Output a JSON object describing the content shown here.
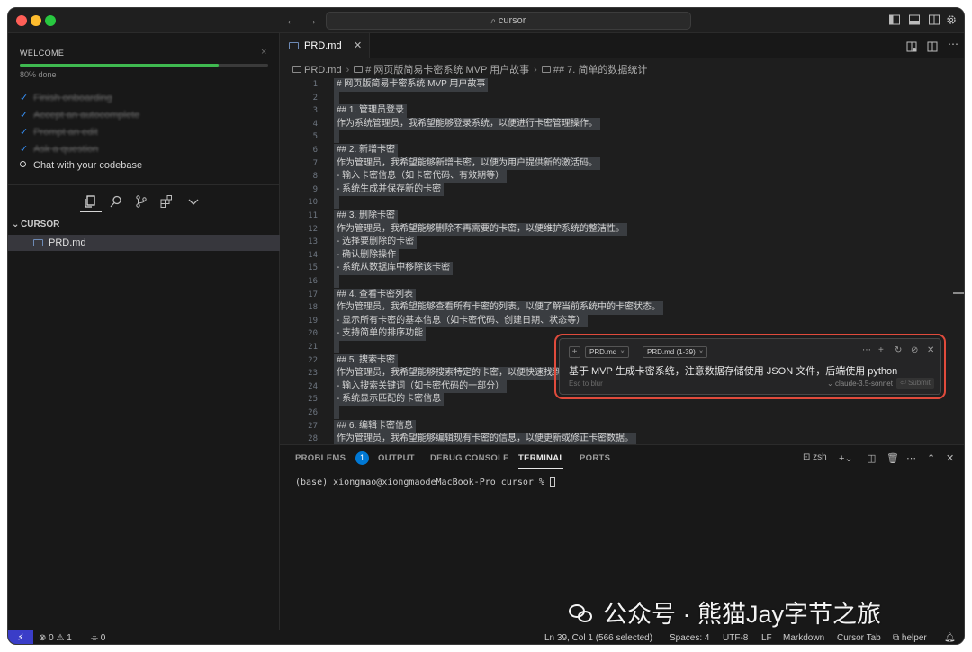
{
  "titlebar": {
    "search": "cursor"
  },
  "welcome": {
    "title": "WELCOME",
    "progress_text": "80% done",
    "progress": 0.8,
    "steps": [
      {
        "label": "Finish onboarding",
        "done": true
      },
      {
        "label": "Accept an autocomplete",
        "done": true
      },
      {
        "label": "Prompt an edit",
        "done": true
      },
      {
        "label": "Ask a question",
        "done": true
      },
      {
        "label": "Chat with your codebase",
        "done": false
      }
    ]
  },
  "explorer": {
    "folder": "CURSOR",
    "files": [
      "PRD.md"
    ]
  },
  "editor": {
    "tab": "PRD.md",
    "breadcrumb": [
      "PRD.md",
      "# 网页版简易卡密系统 MVP 用户故事",
      "## 7. 简单的数据统计"
    ],
    "lines": [
      {
        "n": "1",
        "t": "# 网页版简易卡密系统 MVP 用户故事"
      },
      {
        "n": "2",
        "t": ""
      },
      {
        "n": "3",
        "t": "## 1. 管理员登录"
      },
      {
        "n": "4",
        "t": "作为系统管理员，我希望能够登录系统，以便进行卡密管理操作。"
      },
      {
        "n": "5",
        "t": ""
      },
      {
        "n": "6",
        "t": "## 2. 新增卡密"
      },
      {
        "n": "7",
        "t": "作为管理员，我希望能够新增卡密，以便为用户提供新的激活码。"
      },
      {
        "n": "8",
        "t": "- 输入卡密信息（如卡密代码、有效期等）"
      },
      {
        "n": "9",
        "t": "- 系统生成并保存新的卡密"
      },
      {
        "n": "10",
        "t": ""
      },
      {
        "n": "11",
        "t": "## 3. 删除卡密"
      },
      {
        "n": "12",
        "t": "作为管理员，我希望能够删除不再需要的卡密，以便维护系统的整洁性。"
      },
      {
        "n": "13",
        "t": "- 选择要删除的卡密"
      },
      {
        "n": "14",
        "t": "- 确认删除操作"
      },
      {
        "n": "15",
        "t": "- 系统从数据库中移除该卡密"
      },
      {
        "n": "16",
        "t": ""
      },
      {
        "n": "17",
        "t": "## 4. 查看卡密列表"
      },
      {
        "n": "18",
        "t": "作为管理员，我希望能够查看所有卡密的列表，以便了解当前系统中的卡密状态。"
      },
      {
        "n": "19",
        "t": "- 显示所有卡密的基本信息（如卡密代码、创建日期、状态等）"
      },
      {
        "n": "20",
        "t": "- 支持简单的排序功能"
      },
      {
        "n": "21",
        "t": ""
      },
      {
        "n": "22",
        "t": "## 5. 搜索卡密"
      },
      {
        "n": "23",
        "t": "作为管理员，我希望能够搜索特定的卡密，以便快速找到所"
      },
      {
        "n": "24",
        "t": "- 输入搜索关键词（如卡密代码的一部分）"
      },
      {
        "n": "25",
        "t": "- 系统显示匹配的卡密信息"
      },
      {
        "n": "26",
        "t": ""
      },
      {
        "n": "27",
        "t": "## 6. 编辑卡密信息"
      },
      {
        "n": "28",
        "t": "作为管理员，我希望能够编辑现有卡密的信息，以便更新或修正卡密数据。"
      }
    ]
  },
  "prompt": {
    "chip1": "PRD.md",
    "chip2": "PRD.md (1-39)",
    "text": "基于 MVP 生成卡密系统，注意数据存储使用 JSON 文件，后端使用 python",
    "hint": "Esc to blur",
    "model": "claude-3.5-sonnet",
    "submit": "Submit"
  },
  "panel": {
    "tabs": [
      "PROBLEMS",
      "OUTPUT",
      "DEBUG CONSOLE",
      "TERMINAL",
      "PORTS"
    ],
    "problems_count": "1",
    "shell": "zsh",
    "terminal_line": "(base) xiongmao@xiongmaodeMacBook-Pro cursor % "
  },
  "statusbar": {
    "errors": "0",
    "warnings": "1",
    "ports": "0",
    "position": "Ln 39, Col 1 (566 selected)",
    "spaces": "Spaces: 4",
    "encoding": "UTF-8",
    "eol": "LF",
    "language": "Markdown",
    "cursor_tab": "Cursor Tab",
    "helper": "helper"
  },
  "watermark": "公众号 · 熊猫Jay字节之旅",
  "colors": {
    "accent": "#0078d4",
    "highlight_border": "#e04b3c",
    "progress": "#3fb950"
  }
}
